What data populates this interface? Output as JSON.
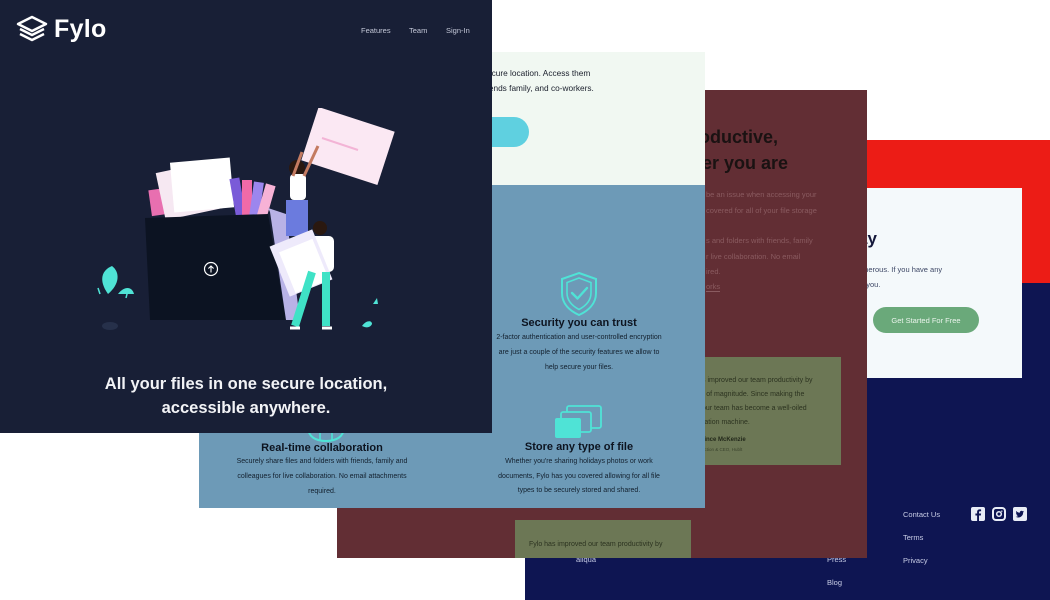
{
  "hero": {
    "brand": "Fylo",
    "nav": [
      "Features",
      "Team",
      "Sign-In"
    ],
    "title_line1": "All your files in one secure location,",
    "title_line2": "accessible anywhere."
  },
  "light_panel": {
    "line1": "ecure location. Access them",
    "line2": "iends family, and co-workers."
  },
  "features": {
    "security_title": "Security you can trust",
    "security_l1": "2-factor authentication and user-controlled encryption",
    "security_l2": "are just a couple of the security features we allow to",
    "security_l3": "help secure your files.",
    "collab_title": "Real-time collaboration",
    "collab_l1": "Securely share files and folders with friends, family and",
    "collab_l2": "colleagues for live collaboration. No email attachments",
    "collab_l3": "required.",
    "store_title": "Store any type of file",
    "store_l1": "Whether you're sharing holidays photos or work",
    "store_l2": "documents, Fylo has you covered allowing for all file",
    "store_l3": "types to be securely stored and shared."
  },
  "maroon_panel": {
    "heading_l1": "roductive,",
    "heading_l2": "ver you are",
    "para_l1": "be an issue when accessing your",
    "para_l2": "covered for all of your file storage",
    "para_l3": "s and folders with friends, family",
    "para_l4": "r live collaboration. No email",
    "para_l5": "ired.",
    "link": "orks",
    "testimonial_l1": "s improved our team productivity by",
    "testimonial_l2": "r of magnitude. Since making the",
    "testimonial_l3": "our team has become a well-oiled",
    "testimonial_l4": "ration machine.",
    "author": "rince McKenzie",
    "author_role": "uction & CEO, Hublt",
    "bottom_l1": "Fylo has improved our team productivity by"
  },
  "cta_panel": {
    "heading": "ay",
    "text_l1": "enerous. If you have any",
    "text_l2": "o you.",
    "button": "Get Started For Free"
  },
  "footer": {
    "left_text": "aliqua",
    "col1": [
      "Press",
      "Blog"
    ],
    "col2": [
      "Contact Us",
      "Terms",
      "Privacy"
    ]
  },
  "colors": {
    "hero_bg": "#181f36",
    "features_bg": "#6d9ab7",
    "maroon_bg": "#622e34",
    "navy_bg": "#0e1552",
    "red_bg": "#ec1c16",
    "accent_cyan": "#5fd0e0",
    "cta_green": "#6aa97a"
  }
}
